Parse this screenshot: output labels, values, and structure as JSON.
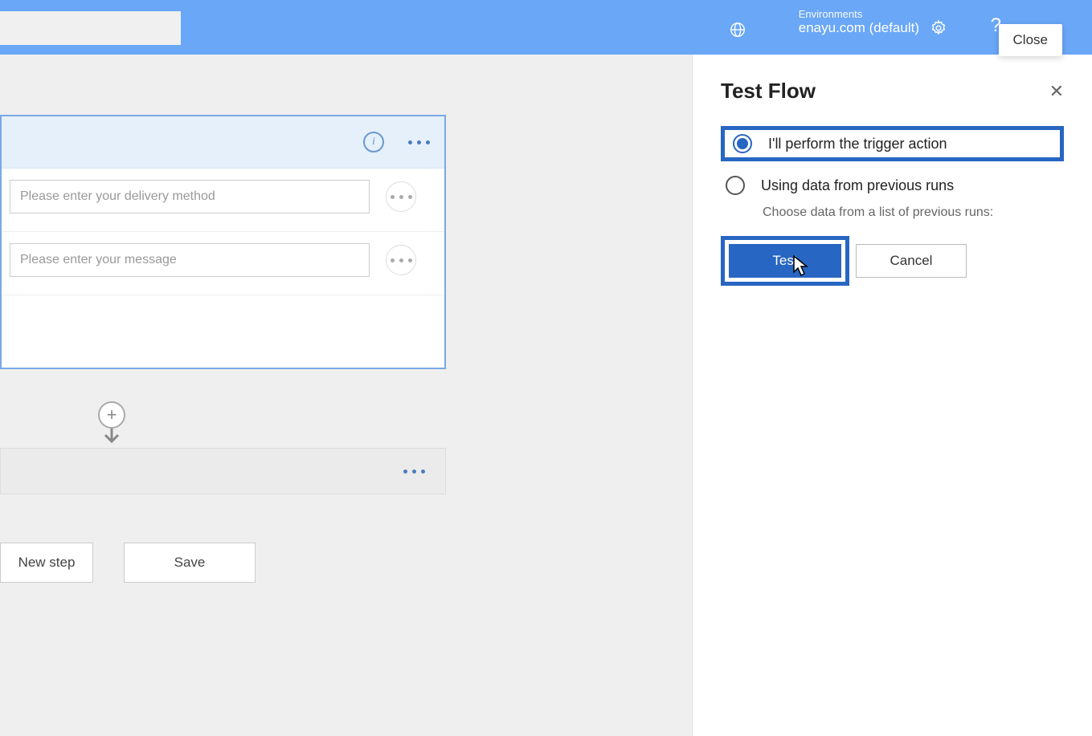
{
  "header": {
    "env_label": "Environments",
    "env_name": "enayu.com (default)",
    "close_tooltip": "Close",
    "help_glyph": "?"
  },
  "flow_card": {
    "inputs": [
      {
        "placeholder": "Please enter your delivery method"
      },
      {
        "placeholder": "Please enter your message"
      }
    ]
  },
  "canvas": {
    "new_step_label": "New step",
    "save_label": "Save",
    "add_glyph": "+"
  },
  "panel": {
    "title": "Test Flow",
    "close_glyph": "✕",
    "options": [
      {
        "label": "I'll perform the trigger action",
        "selected": true
      },
      {
        "label": "Using data from previous runs",
        "selected": false
      }
    ],
    "previous_runs_desc": "Choose data from a list of previous runs:",
    "test_label": "Test",
    "cancel_label": "Cancel"
  }
}
